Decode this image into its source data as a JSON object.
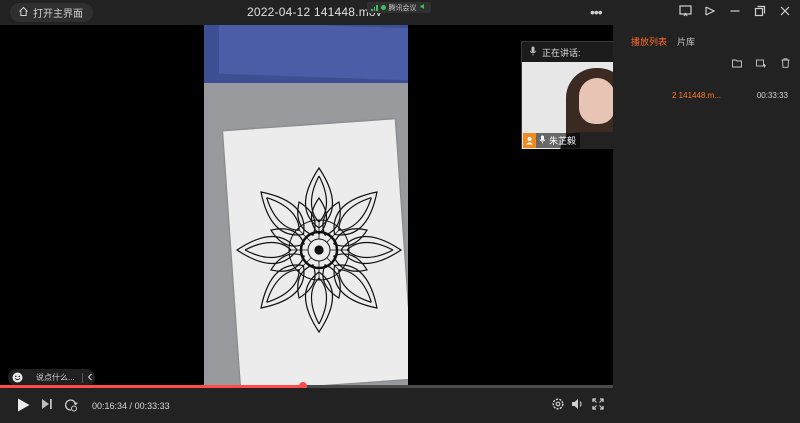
{
  "titlebar": {
    "home_button_label": "打开主界面",
    "title": "2022-04-12 141448.mov",
    "meeting_app_label": "腾讯会议",
    "more_label": "•••"
  },
  "speaker": {
    "header_label": "正在讲话:",
    "name": "朱芷毅"
  },
  "sidebar": {
    "tabs": [
      "播放列表",
      "片库"
    ],
    "playlist": [
      {
        "name": "2 141448.m...",
        "duration": "00:33:33"
      }
    ]
  },
  "comment": {
    "placeholder": "说点什么..."
  },
  "player": {
    "current_time": "00:16:34",
    "separator": " / ",
    "total_time": "00:33:33",
    "progress": 0.494
  },
  "colors": {
    "accent": "#ff6a2a",
    "progress": "#ff4b4b",
    "signal": "#3fbf5f"
  }
}
